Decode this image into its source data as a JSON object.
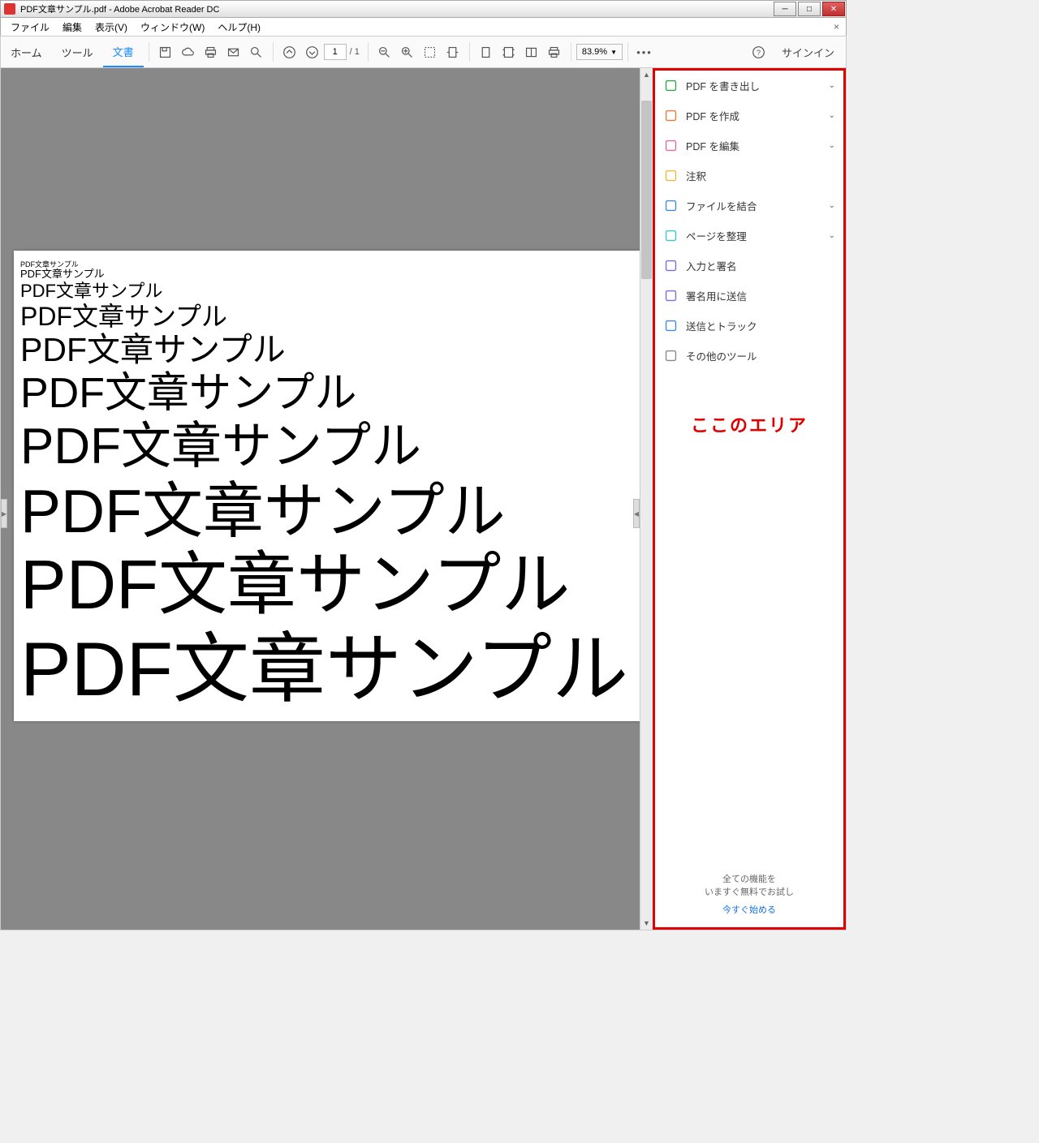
{
  "window": {
    "title": "PDF文章サンプル.pdf - Adobe Acrobat Reader DC"
  },
  "menu": {
    "file": "ファイル",
    "edit": "編集",
    "view": "表示(V)",
    "window": "ウィンドウ(W)",
    "help": "ヘルプ(H)"
  },
  "tabs": {
    "home": "ホーム",
    "tool": "ツール",
    "document": "文書"
  },
  "page_nav": {
    "current": "1",
    "total": "/ 1"
  },
  "zoom": {
    "value": "83.9%"
  },
  "signin": "サインイン",
  "document": {
    "lines": [
      {
        "text": "PDF文章サンプル",
        "size": 9
      },
      {
        "text": "PDF文章サンプル",
        "size": 13
      },
      {
        "text": "PDF文章サンプル",
        "size": 22
      },
      {
        "text": "PDF文章サンプル",
        "size": 32
      },
      {
        "text": "PDF文章サンプル",
        "size": 41
      },
      {
        "text": "PDF文章サンプル",
        "size": 52
      },
      {
        "text": "PDF文章サンプル",
        "size": 62
      },
      {
        "text": "PDF文章サンプル",
        "size": 75
      },
      {
        "text": "PDF文章サンプル",
        "size": 85
      },
      {
        "text": "PDF文章サンプル",
        "size": 94
      }
    ]
  },
  "right_panel": {
    "items": [
      {
        "label": "PDF を書き出し",
        "icon_color": "#2ba84a",
        "expandable": true
      },
      {
        "label": "PDF を作成",
        "icon_color": "#e67a3c",
        "expandable": true
      },
      {
        "label": "PDF を編集",
        "icon_color": "#e66aa0",
        "expandable": true
      },
      {
        "label": "注釈",
        "icon_color": "#f0b83c",
        "expandable": false
      },
      {
        "label": "ファイルを結合",
        "icon_color": "#3c8ce6",
        "expandable": true
      },
      {
        "label": "ページを整理",
        "icon_color": "#3cc6c6",
        "expandable": true
      },
      {
        "label": "入力と署名",
        "icon_color": "#7a6ae6",
        "expandable": false
      },
      {
        "label": "署名用に送信",
        "icon_color": "#7a6ae6",
        "expandable": false
      },
      {
        "label": "送信とトラック",
        "icon_color": "#3c8ce6",
        "expandable": false
      },
      {
        "label": "その他のツール",
        "icon_color": "#888888",
        "expandable": false
      }
    ],
    "annotation_text": "ここのエリア",
    "footer_line1": "全ての機能を",
    "footer_line2": "いますぐ無料でお試し",
    "footer_link": "今すぐ始める"
  }
}
